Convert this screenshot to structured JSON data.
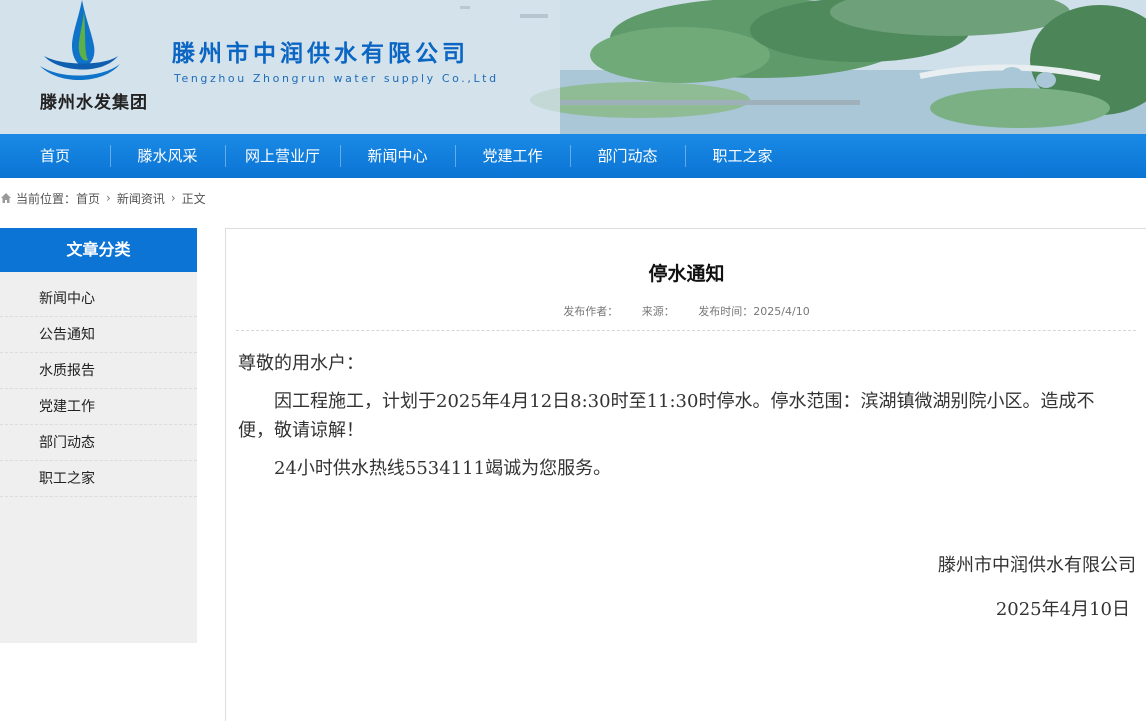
{
  "header": {
    "logo_text": "滕州水发集团",
    "company_name": "滕州市中润供水有限公司",
    "company_name_en": "Tengzhou Zhongrun water supply Co.,Ltd",
    "brand_color": "#0b66c3"
  },
  "nav": {
    "items": [
      "首页",
      "滕水风采",
      "网上营业厅",
      "新闻中心",
      "党建工作",
      "部门动态",
      "职工之家"
    ],
    "bar_color": "#0b74d4"
  },
  "breadcrumb": {
    "icon": "home-icon",
    "label": "当前位置：",
    "items": [
      "首页",
      "新闻资讯",
      "正文"
    ]
  },
  "sidebar": {
    "title": "文章分类",
    "items": [
      "新闻中心",
      "公告通知",
      "水质报告",
      "党建工作",
      "部门动态",
      "职工之家"
    ]
  },
  "article": {
    "title": "停水通知",
    "meta": {
      "author_label": "发布作者：",
      "source_label": "来源：",
      "time": "发布时间：2025/4/10"
    },
    "greeting": "尊敬的用水户：",
    "paragraphs": [
      "因工程施工，计划于2025年4月12日8:30时至11:30时停水。停水范围：滨湖镇微湖别院小区。造成不便，敬请谅解！",
      "24小时供水热线5534111竭诚为您服务。"
    ],
    "signature": "滕州市中润供水有限公司",
    "date": "2025年4月10日"
  }
}
